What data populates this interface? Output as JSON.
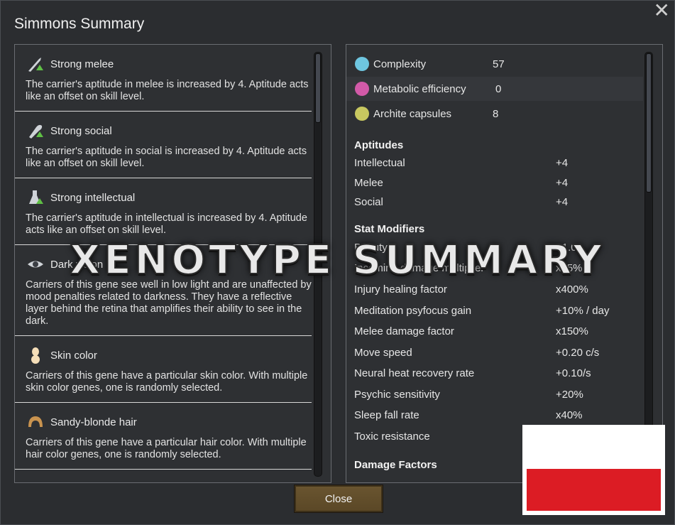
{
  "window": {
    "title": "Simmons Summary"
  },
  "genes": [
    {
      "icon": "melee-sword-arrow-icon",
      "name": "Strong melee",
      "description": "The carrier's aptitude in melee is increased by 4. Aptitude acts like an offset on skill level."
    },
    {
      "icon": "social-arrow-icon",
      "name": "Strong social",
      "description": "The carrier's aptitude in social is increased by 4. Aptitude acts like an offset on skill level."
    },
    {
      "icon": "flask-arrow-icon",
      "name": "Strong intellectual",
      "description": "The carrier's aptitude in intellectual is increased by 4. Aptitude acts like an offset on skill level."
    },
    {
      "icon": "eye-icon",
      "name": "Dark vision",
      "description": "Carriers of this gene see well in low light and are unaffected by mood penalties related to darkness. They have a reflective layer behind the retina that amplifies their ability to see in the dark."
    },
    {
      "icon": "skin-color-icon",
      "name": "Skin color",
      "description": "Carriers of this gene have a particular skin color. With multiple skin color genes, one is randomly selected."
    },
    {
      "icon": "hair-icon",
      "name": "Sandy-blonde hair",
      "description": "Carriers of this gene have a particular hair color. With multiple hair color genes, one is randomly selected."
    }
  ],
  "stats": [
    {
      "icon": "complexity-icon",
      "color": "#6ec6e0",
      "label": "Complexity",
      "value": "57"
    },
    {
      "icon": "metabolic-icon",
      "color": "#d25aa8",
      "label": "Metabolic efficiency",
      "value": "0"
    },
    {
      "icon": "archite-capsule-icon",
      "color": "#c8c860",
      "label": "Archite capsules",
      "value": "8"
    }
  ],
  "aptitudes": {
    "title": "Aptitudes",
    "rows": [
      {
        "label": "Intellectual",
        "value": "+4"
      },
      {
        "label": "Melee",
        "value": "+4"
      },
      {
        "label": "Social",
        "value": "+4"
      }
    ]
  },
  "stat_modifiers": {
    "title": "Stat Modifiers",
    "rows": [
      {
        "label": "Beauty",
        "value": "+1.0"
      },
      {
        "label": "Incoming damage multiplier",
        "value": "x75%"
      },
      {
        "label": "Injury healing factor",
        "value": "x400%"
      },
      {
        "label": "Meditation psyfocus gain",
        "value": "+10% / day"
      },
      {
        "label": "Melee damage factor",
        "value": "x150%"
      },
      {
        "label": "Move speed",
        "value": "+0.20 c/s"
      },
      {
        "label": "Neural heat recovery rate",
        "value": "+0.10/s"
      },
      {
        "label": "Psychic sensitivity",
        "value": "+20%"
      },
      {
        "label": "Sleep fall rate",
        "value": "x40%"
      },
      {
        "label": "Toxic resistance",
        "value": ""
      }
    ]
  },
  "damage_factors": {
    "title": "Damage Factors"
  },
  "buttons": {
    "close": "Close"
  },
  "overlay": {
    "text": "XENOTYPE SUMMARY",
    "flag_colors": [
      "#ffffff",
      "#dc1c24"
    ]
  }
}
